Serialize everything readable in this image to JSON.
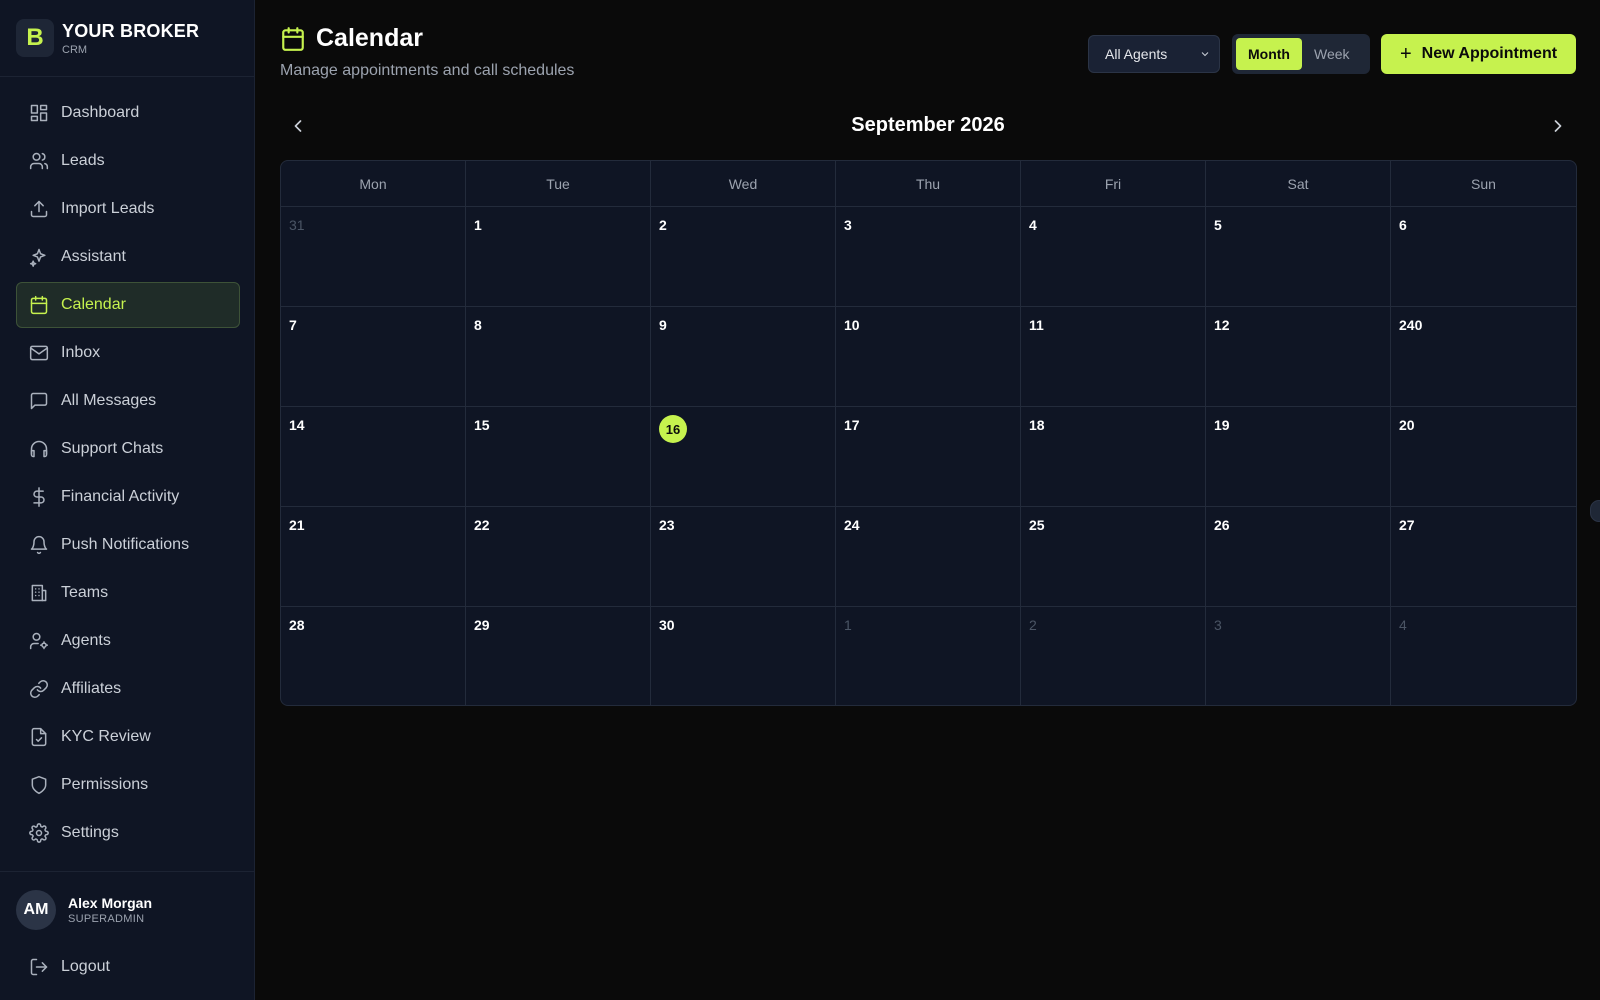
{
  "brand": {
    "logo_letter": "B",
    "name": "YOUR BROKER",
    "sub": "CRM"
  },
  "nav": [
    {
      "label": "Dashboard",
      "icon": "dashboard-icon"
    },
    {
      "label": "Leads",
      "icon": "users-icon"
    },
    {
      "label": "Import Leads",
      "icon": "upload-icon"
    },
    {
      "label": "Assistant",
      "icon": "sparkles-icon"
    },
    {
      "label": "Calendar",
      "icon": "calendar-icon",
      "active": true
    },
    {
      "label": "Inbox",
      "icon": "mail-icon"
    },
    {
      "label": "All Messages",
      "icon": "message-icon"
    },
    {
      "label": "Support Chats",
      "icon": "headphones-icon"
    },
    {
      "label": "Financial Activity",
      "icon": "dollar-icon"
    },
    {
      "label": "Push Notifications",
      "icon": "bell-icon"
    },
    {
      "label": "Teams",
      "icon": "building-icon"
    },
    {
      "label": "Agents",
      "icon": "user-cog-icon"
    },
    {
      "label": "Affiliates",
      "icon": "link-icon"
    },
    {
      "label": "KYC Review",
      "icon": "file-check-icon"
    },
    {
      "label": "Permissions",
      "icon": "shield-icon"
    },
    {
      "label": "Settings",
      "icon": "gear-icon"
    }
  ],
  "user": {
    "initials": "AM",
    "name": "Alex Morgan",
    "role": "SUPERADMIN"
  },
  "logout_label": "Logout",
  "page": {
    "title": "Calendar",
    "subtitle": "Manage appointments and call schedules"
  },
  "toolbar": {
    "agent_filter": "All Agents",
    "view_month": "Month",
    "view_week": "Week",
    "active_view": "Month",
    "new_appointment": "New Appointment"
  },
  "calendar": {
    "month_label": "September 2026",
    "weekdays": [
      "Mon",
      "Tue",
      "Wed",
      "Thu",
      "Fri",
      "Sat",
      "Sun"
    ],
    "days": [
      {
        "d": "31",
        "other": true
      },
      {
        "d": "1"
      },
      {
        "d": "2"
      },
      {
        "d": "3"
      },
      {
        "d": "4"
      },
      {
        "d": "5"
      },
      {
        "d": "6"
      },
      {
        "d": "7"
      },
      {
        "d": "8"
      },
      {
        "d": "9"
      },
      {
        "d": "10"
      },
      {
        "d": "11"
      },
      {
        "d": "12"
      },
      {
        "d": "240"
      },
      {
        "d": "14"
      },
      {
        "d": "15"
      },
      {
        "d": "16",
        "today": true
      },
      {
        "d": "17"
      },
      {
        "d": "18"
      },
      {
        "d": "19"
      },
      {
        "d": "20"
      },
      {
        "d": "21"
      },
      {
        "d": "22"
      },
      {
        "d": "23"
      },
      {
        "d": "24"
      },
      {
        "d": "25"
      },
      {
        "d": "26"
      },
      {
        "d": "27"
      },
      {
        "d": "28"
      },
      {
        "d": "29"
      },
      {
        "d": "30"
      },
      {
        "d": "1",
        "other": true
      },
      {
        "d": "2",
        "other": true
      },
      {
        "d": "3",
        "other": true
      },
      {
        "d": "4",
        "other": true
      }
    ]
  },
  "colors": {
    "accent": "#c6f24e",
    "sidebar_bg": "#0f1524",
    "page_bg": "#0a0a0a"
  }
}
